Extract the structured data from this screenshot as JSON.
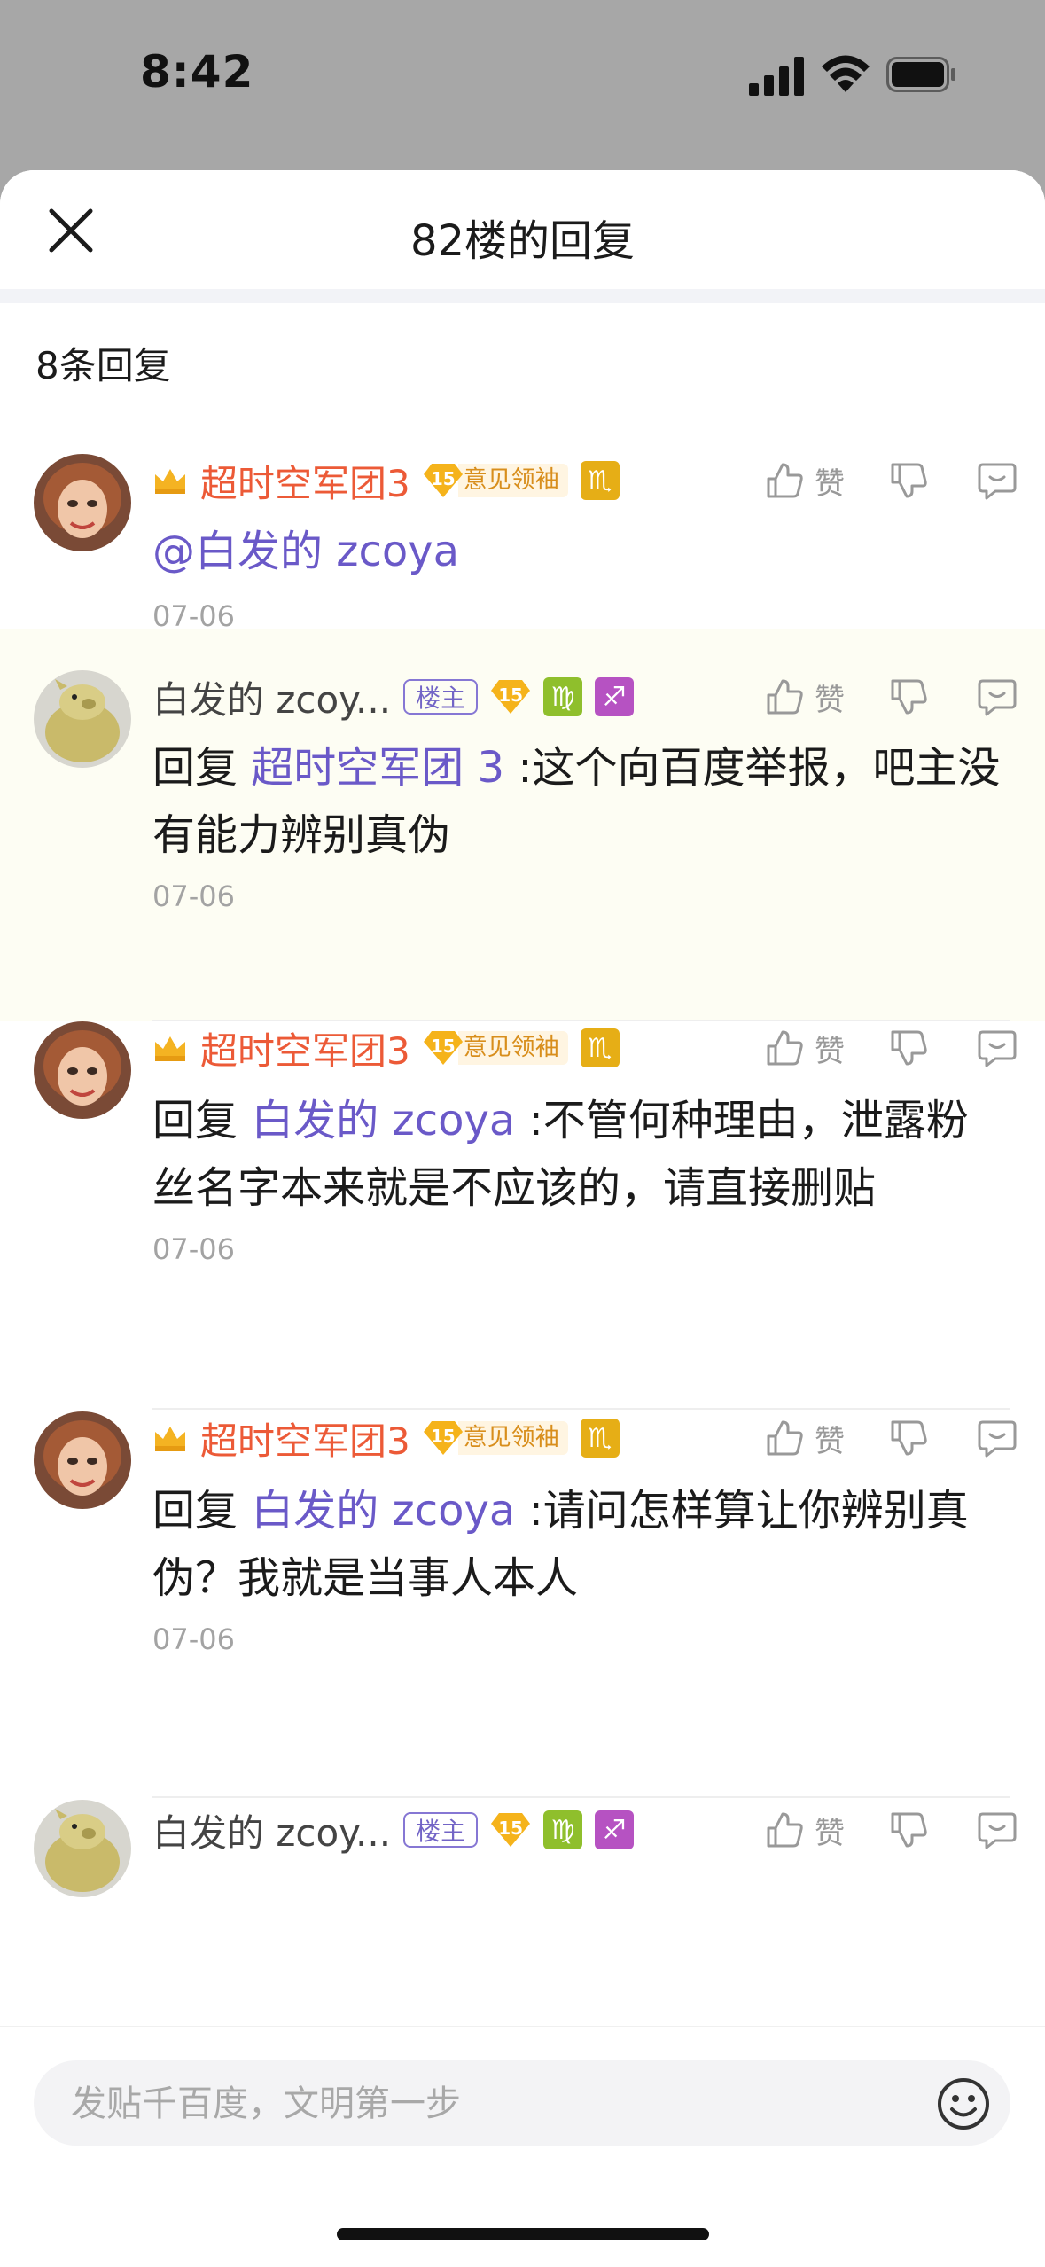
{
  "status_bar": {
    "time": "8:42"
  },
  "sheet": {
    "title": "82楼的回复",
    "reply_count": "8条回复"
  },
  "replies": [
    {
      "username": "超时空军团3",
      "name_color": "red",
      "level": "15",
      "badge": "意见领袖",
      "zodiacs": [
        {
          "glyph": "♏",
          "color": "gold"
        }
      ],
      "like_label": "赞",
      "prefix": "",
      "mention": "@白发的 zcoya",
      "text": "",
      "date": "07-06"
    },
    {
      "username": "白发的 zcoy...",
      "name_color": "gray",
      "owner_tag": "楼主",
      "level": "15",
      "zodiacs": [
        {
          "glyph": "♍",
          "color": "green"
        },
        {
          "glyph": "♐",
          "color": "purple"
        }
      ],
      "like_label": "赞",
      "prefix": "回复 ",
      "mention": "超时空军团 3",
      "text": " :这个向百度举报，吧主没有能力辨别真伪",
      "date": "07-06"
    },
    {
      "username": "超时空军团3",
      "name_color": "red",
      "level": "15",
      "badge": "意见领袖",
      "zodiacs": [
        {
          "glyph": "♏",
          "color": "gold"
        }
      ],
      "like_label": "赞",
      "prefix": "回复 ",
      "mention": "白发的 zcoya",
      "text": " :不管何种理由，泄露粉丝名字本来就是不应该的，请直接删贴",
      "date": "07-06"
    },
    {
      "username": "超时空军团3",
      "name_color": "red",
      "level": "15",
      "badge": "意见领袖",
      "zodiacs": [
        {
          "glyph": "♏",
          "color": "gold"
        }
      ],
      "like_label": "赞",
      "prefix": "回复 ",
      "mention": "白发的 zcoya",
      "text": " :请问怎样算让你辨别真伪？我就是当事人本人",
      "date": "07-06"
    },
    {
      "username": "白发的 zcoy...",
      "name_color": "gray",
      "owner_tag": "楼主",
      "level": "15",
      "zodiacs": [
        {
          "glyph": "♍",
          "color": "green"
        },
        {
          "glyph": "♐",
          "color": "purple"
        }
      ],
      "like_label": "赞"
    }
  ],
  "input": {
    "placeholder": "发贴千百度，文明第一步"
  },
  "colors": {
    "accent_purple": "#6a59c8",
    "username_red": "#ec5a37",
    "badge_gold": "#f5b31b"
  }
}
